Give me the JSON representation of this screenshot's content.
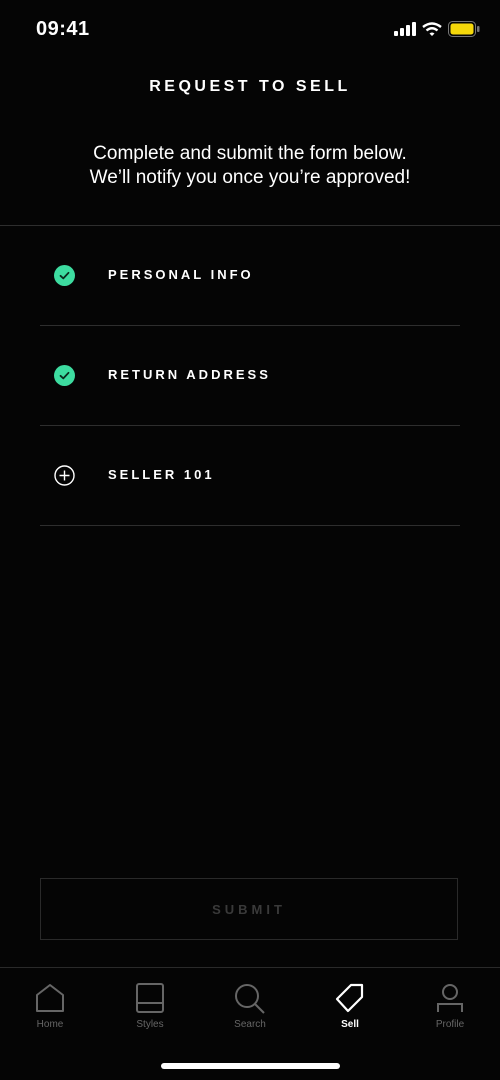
{
  "status_bar": {
    "time": "09:41",
    "battery_color": "#f5d80a"
  },
  "header": {
    "title": "REQUEST TO SELL",
    "subtitle_line1": "Complete and submit the form below.",
    "subtitle_line2": "We’ll notify you once you’re approved!"
  },
  "steps": [
    {
      "label": "PERSONAL INFO",
      "status": "complete",
      "icon": "check-circle-icon"
    },
    {
      "label": "RETURN ADDRESS",
      "status": "complete",
      "icon": "check-circle-icon"
    },
    {
      "label": "SELLER 101",
      "status": "incomplete",
      "icon": "plus-circle-icon"
    }
  ],
  "colors": {
    "accent": "#3ddca0",
    "background": "#050505"
  },
  "submit": {
    "label": "SUBMIT",
    "enabled": false
  },
  "tabbar": {
    "items": [
      {
        "label": "Home",
        "icon": "home-icon",
        "active": false
      },
      {
        "label": "Styles",
        "icon": "styles-icon",
        "active": false
      },
      {
        "label": "Search",
        "icon": "search-icon",
        "active": false
      },
      {
        "label": "Sell",
        "icon": "tag-icon",
        "active": true
      },
      {
        "label": "Profile",
        "icon": "profile-icon",
        "active": false
      }
    ]
  }
}
